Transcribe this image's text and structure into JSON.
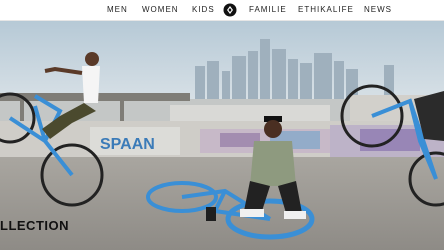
{
  "nav": {
    "items": [
      {
        "label": "MEN"
      },
      {
        "label": "WOMEN"
      },
      {
        "label": "KIDS"
      },
      {
        "label": "FAMILIE"
      },
      {
        "label": "ETHIKALIFE"
      },
      {
        "label": "NEWS"
      }
    ],
    "logo_icon": "brand-logo-icon"
  },
  "hero": {
    "graffiti_text": "SPAAN",
    "collection_title": "LLECTION"
  },
  "colors": {
    "nav_text": "#222222",
    "bike_blue": "#3a8fd6",
    "sky": "#c9d9e4"
  }
}
